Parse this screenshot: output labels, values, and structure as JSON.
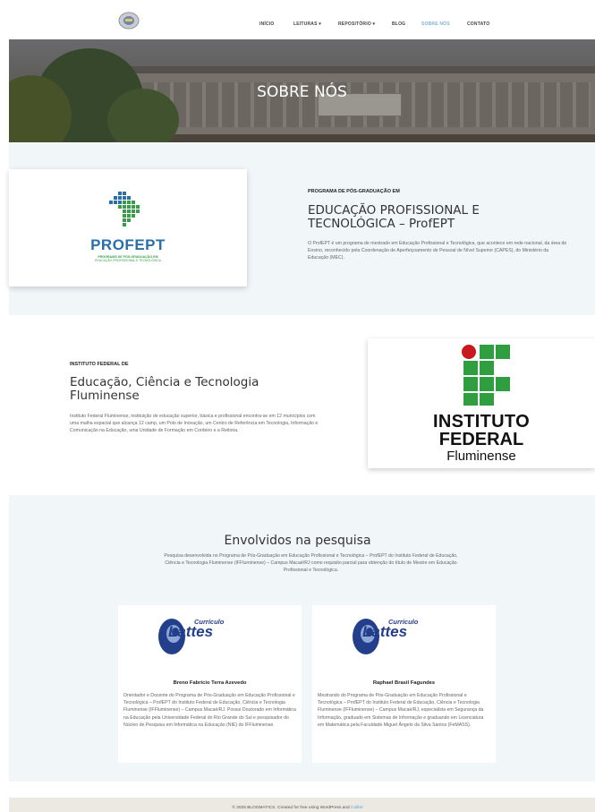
{
  "header": {
    "nav": [
      {
        "label": "INÍCIO",
        "active": false
      },
      {
        "label": "LEITURAS ▾",
        "active": false
      },
      {
        "label": "REPOSITÓRIO ▾",
        "active": false
      },
      {
        "label": "BLOG",
        "active": false
      },
      {
        "label": "SOBRE NÓS",
        "active": true
      },
      {
        "label": "CONTATO",
        "active": false
      }
    ]
  },
  "hero": {
    "title": "SOBRE NÓS"
  },
  "section1": {
    "logo": {
      "name": "PROFEPT",
      "subtitle": "PROGRAMA DE PÓS-GRADUAÇÃO EM",
      "subtitle2": "EDUCAÇÃO PROFISSIONAL E TECNOLÓGICA"
    },
    "kicker": "PROGRAMA DE PÓS-GRADUAÇÃO EM",
    "title": "EDUCAÇÃO PROFISSIONAL E TECNOLÓGICA – ProfEPT",
    "body": "O ProfEPT é um programa de mestrado em Educação Profissional e Tecnológica, que acontece em rede nacional, da área de Ensino, reconhecido pela Coordenação de Aperfeiçoamento de Pessoal de Nível Superior (CAPES), do Ministério da Educação (MEC)."
  },
  "section2": {
    "kicker": "INSTITUTO FEDERAL DE",
    "title": "Educação, Ciência e Tecnologia Fluminense",
    "body": "Instituto Federal Fluminense, instituição de educação superior, básica e profissional encontra-se em 12 municípios com uma malha espacial que alcança 12 camp, um Polo de Inovação, um Centro de Referência em Tecnologia, Informação e Comunicação na Educação, uma Unidade de Formação em Cordeiro e a Reitoria.",
    "logo": {
      "line1": "INSTITUTO",
      "line2": "FEDERAL",
      "line3": "Fluminense"
    }
  },
  "section3": {
    "title": "Envolvidos na pesquisa",
    "body": "Pesquisa desenvolvida no Programa de Pós-Graduação em Educação Profissional e Tecnológica – ProfEPT do Instituto Federal de Educação, Ciência e Tecnologia Fluminense (IFFluminense) – Campus Macaé/RJ como requisito parcial para obtenção do título de Mestre em Educação Profissional e Tecnológica.",
    "people": [
      {
        "logo_small": "Currículo",
        "logo_big": "Lattes",
        "name": "Breno Fabrício Terra Azevedo",
        "desc": "Orientador e Docente do Programa de Pós-Graduação em Educação Profissional e Tecnológica – ProfEPT do Instituto Federal de Educação, Ciência e Tecnologia Fluminense (IFFluminense) – Campus Macaé/RJ. Possui Doutorado em Informática na Educação pela Universidade Federal do Rio Grande do Sul e pesquisador do Núcleo de Pesquisa em Informática na Educação (NIE) do IFFluminense."
      },
      {
        "logo_small": "Currículo",
        "logo_big": "Lattes",
        "name": "Raphael Brasil Fagundes",
        "desc": "Mestrando do Programa de Pós-Graduação em Educação Profissional e Tecnológica – ProfEPT do Instituto Federal de Educação, Ciência e Tecnologia Fluminense (IFFluminense) – Campus Macaé/RJ, especialista em Segurança da Informação, graduado em Sistemas de Informação e graduando em Licenciatura em Matemática pela Faculdade Miguel Ângelo da Silva Santos (FeMASS)."
      }
    ]
  },
  "footer": {
    "text": "© 2025 BLOGMATICS. Created for free using WordPress and",
    "link": "Colibri"
  },
  "colors": {
    "accent": "#7fb2d8",
    "section_bg": "#f1f6f9",
    "profept_blue": "#2b6fa8",
    "profept_green": "#3a9b4a",
    "if_green": "#2f9e41",
    "if_red": "#c8191e",
    "lattes_blue": "#233e8b"
  }
}
